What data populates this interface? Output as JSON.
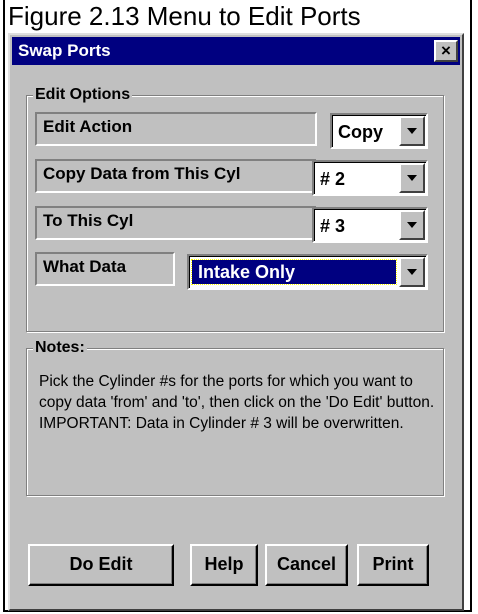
{
  "figure_caption": "Figure 2.13 Menu to Edit Ports",
  "window": {
    "title": "Swap Ports",
    "close_glyph": "×"
  },
  "edit_options": {
    "legend": "Edit Options",
    "edit_action": {
      "label": "Edit Action",
      "value": "Copy"
    },
    "copy_from": {
      "label": "Copy Data from This Cyl",
      "value": "# 2"
    },
    "to_cyl": {
      "label": "To This Cyl",
      "value": "# 3"
    },
    "what_data": {
      "label": "What Data",
      "value": "Intake Only"
    }
  },
  "notes": {
    "legend": "Notes:",
    "text": "Pick the Cylinder #s for the ports for which you want to  copy data 'from' and 'to', then click on the 'Do Edit' button.    IMPORTANT:  Data in Cylinder # 3 will be overwritten."
  },
  "buttons": {
    "do_edit": "Do Edit",
    "help": "Help",
    "cancel": "Cancel",
    "print": "Print"
  },
  "colors": {
    "titlebar": "#000080",
    "face": "#c0c0c0",
    "selection": "#000080"
  }
}
